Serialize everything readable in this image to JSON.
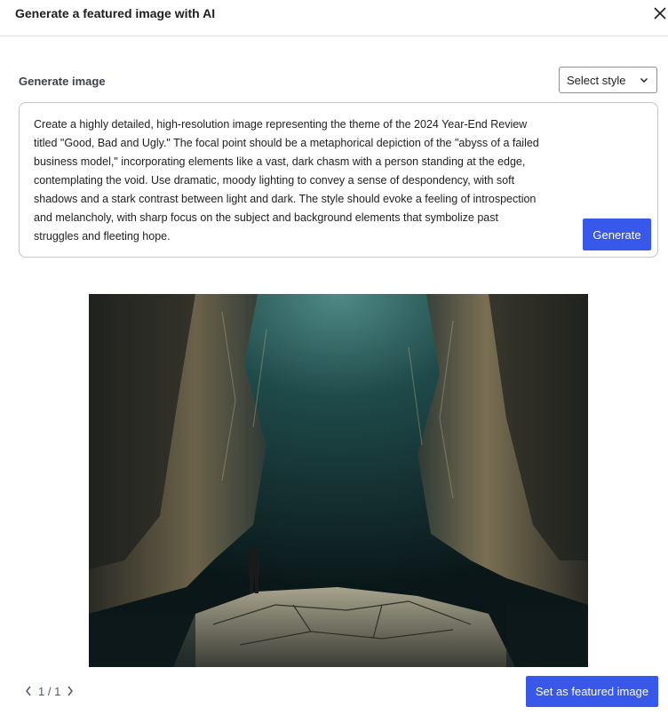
{
  "header": {
    "title": "Generate a featured image with AI",
    "close_icon": "close-icon"
  },
  "form": {
    "label": "Generate image",
    "style_select": {
      "value": "Select style",
      "icon": "chevron-down-icon"
    },
    "prompt": "Create a highly detailed, high-resolution image representing the theme of the 2024 Year-End Review titled \"Good, Bad and Ugly.\" The focal point should be a metaphorical depiction of the \"abyss of a failed business model,\" incorporating elements like a vast, dark chasm with a person standing at the edge, contemplating the void. Use dramatic, moody lighting to convey a sense of despondency, with soft shadows and a stark contrast between light and dark. The style should evoke a feeling of introspection and melancholy, with sharp focus on the subject and background elements that symbolize past struggles and fleeting hope.",
    "generate_label": "Generate"
  },
  "preview": {
    "image_subject": "dark canyon chasm with a person standing on a rock ledge"
  },
  "footer": {
    "pagination": "1 / 1",
    "prev_icon": "chevron-left-icon",
    "next_icon": "chevron-right-icon",
    "set_label": "Set as featured image"
  },
  "colors": {
    "accent": "#3858e9",
    "border": "#c3c4c7"
  }
}
